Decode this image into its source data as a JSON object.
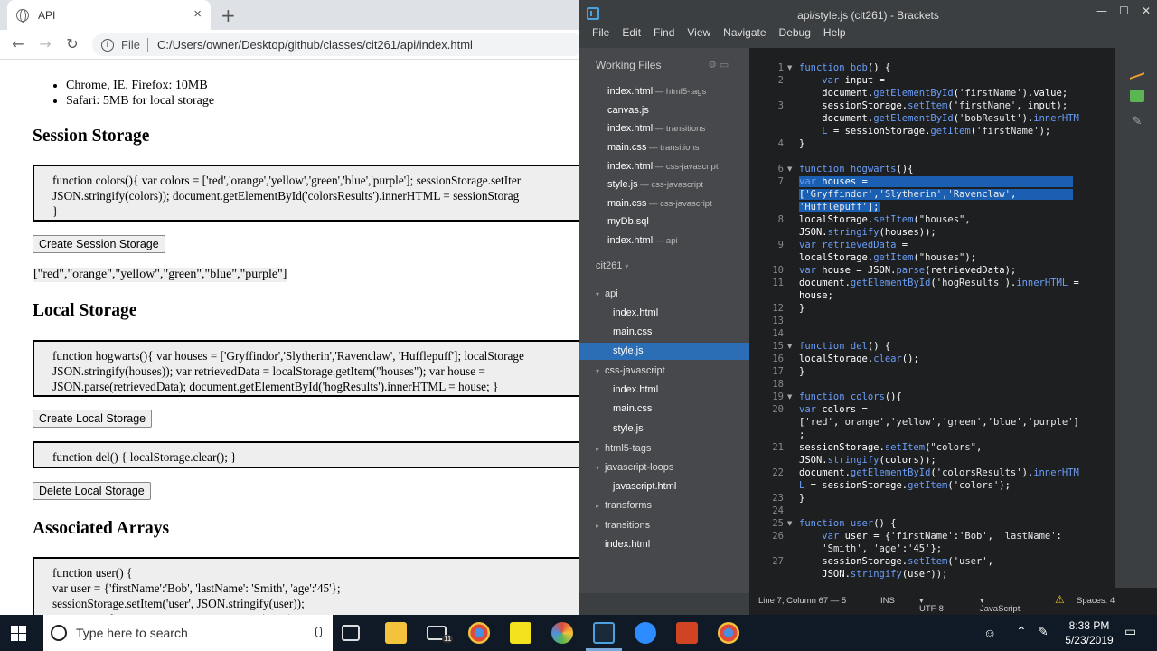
{
  "browser": {
    "tab_title": "API",
    "close_tab": "×",
    "new_tab": "+",
    "file_label": "File",
    "url": "C:/Users/owner/Desktop/github/classes/cit261/api/index.html"
  },
  "page": {
    "bullets": [
      "Chrome, IE, Firefox: 10MB",
      "Safari: 5MB for local storage"
    ],
    "session_heading": "Session Storage",
    "session_code": "function colors(){ var colors = ['red','orange','yellow','green','blue','purple']; sessionStorage.setIter\nJSON.stringify(colors)); document.getElementById('colorsResults').innerHTML = sessionStorag\n}",
    "session_button": "Create Session Storage",
    "session_result": "[\"red\",\"orange\",\"yellow\",\"green\",\"blue\",\"purple\"]",
    "local_heading": "Local Storage",
    "local_code": "function hogwarts(){ var houses = ['Gryffindor','Slytherin','Ravenclaw', 'Hufflepuff']; localStorage\nJSON.stringify(houses)); var retrievedData = localStorage.getItem(\"houses\"); var house =\nJSON.parse(retrievedData); document.getElementById('hogResults').innerHTML = house; }",
    "local_button": "Create Local Storage",
    "del_code": "function del() { localStorage.clear(); }",
    "delete_button": "Delete Local Storage",
    "assoc_heading": "Associated Arrays",
    "assoc_code": "function user() {\nvar user = {'firstName':'Bob', 'lastName': 'Smith', 'age':'45'};\nsessionStorage.setItem('user', JSON.stringify(user));\nvar retrievedData = sessionStorage.getItem('user');"
  },
  "brackets": {
    "title": "api/style.js (cit261) - Brackets",
    "menu": [
      "File",
      "Edit",
      "Find",
      "View",
      "Navigate",
      "Debug",
      "Help"
    ],
    "working_files_label": "Working Files",
    "working_files": [
      {
        "name": "index.html",
        "ctx": " — html5-tags"
      },
      {
        "name": "canvas.js",
        "ctx": ""
      },
      {
        "name": "index.html",
        "ctx": " — transitions"
      },
      {
        "name": "main.css",
        "ctx": " — transitions"
      },
      {
        "name": "index.html",
        "ctx": " — css-javascript"
      },
      {
        "name": "style.js",
        "ctx": " — css-javascript"
      },
      {
        "name": "main.css",
        "ctx": " — css-javascript"
      },
      {
        "name": "myDb.sql",
        "ctx": ""
      },
      {
        "name": "index.html",
        "ctx": " — api"
      }
    ],
    "project": "cit261",
    "tree": {
      "api": "api",
      "api_files": [
        "index.html",
        "main.css",
        "style.js"
      ],
      "css_js": "css-javascript",
      "css_js_files": [
        "index.html",
        "main.css",
        "style.js"
      ],
      "html5": "html5-tags",
      "jsloops": "javascript-loops",
      "jsloops_files": [
        "javascript.html"
      ],
      "transforms": "transforms",
      "transitions": "transitions",
      "root_index": "index.html"
    },
    "status": {
      "cursor": "Line 7, Column 67 — 5",
      "ins": "INS",
      "encoding": "UTF-8",
      "language": "JavaScript",
      "spaces": "Spaces: 4"
    }
  },
  "taskbar": {
    "search_placeholder": "Type here to search",
    "time": "8:38 PM",
    "date": "5/23/2019",
    "mail_badge": "11"
  }
}
